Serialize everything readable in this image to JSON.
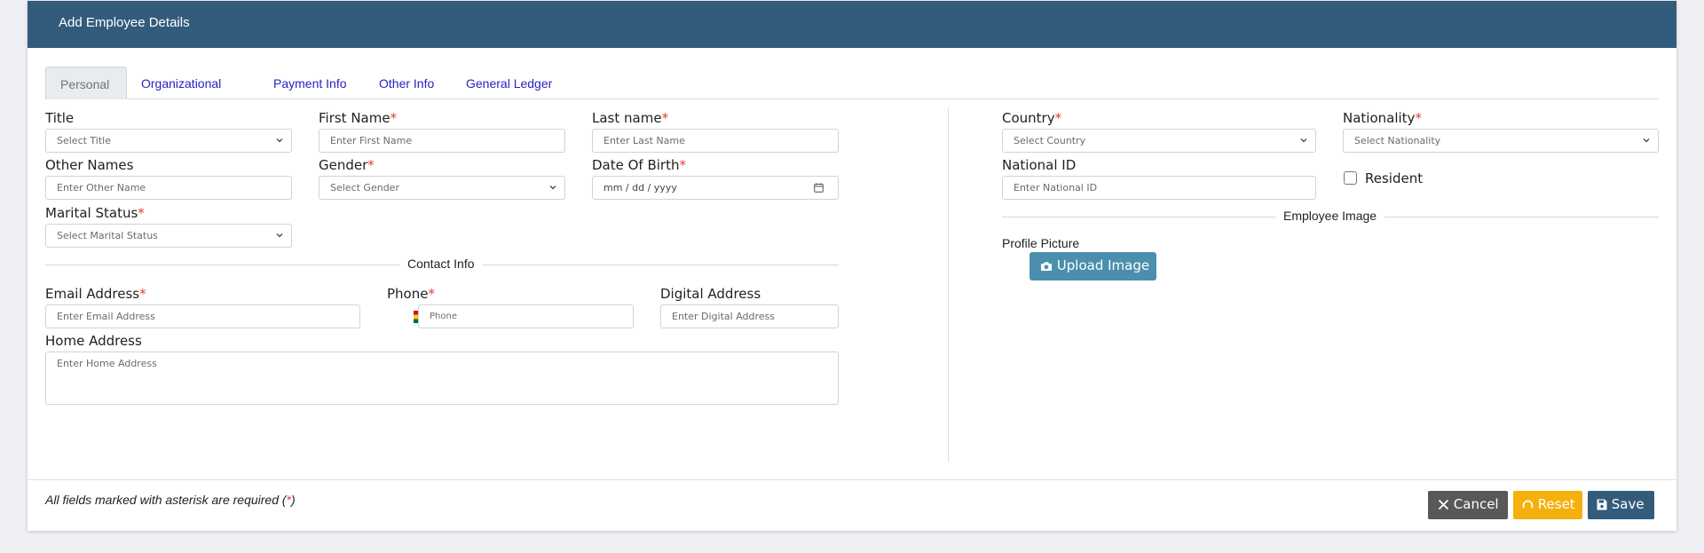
{
  "header": {
    "title": "Add Employee Details"
  },
  "tabs": [
    "Personal",
    "Organizational",
    "Payment Info",
    "Other Info",
    "General Ledger"
  ],
  "form": {
    "title": {
      "label": "Title",
      "placeholder": "Select Title"
    },
    "first_name": {
      "label": "First Name",
      "placeholder": "Enter First Name"
    },
    "last_name": {
      "label": "Last name",
      "placeholder": "Enter Last Name"
    },
    "other_names": {
      "label": "Other Names",
      "placeholder": "Enter Other Name"
    },
    "gender": {
      "label": "Gender",
      "placeholder": "Select Gender"
    },
    "dob": {
      "label": "Date Of Birth",
      "placeholder": "mm / dd / yyyy"
    },
    "marital_status": {
      "label": "Marital Status",
      "placeholder": "Select Marital Status"
    },
    "contact_heading": "Contact Info",
    "email": {
      "label": "Email Address",
      "placeholder": "Enter Email Address"
    },
    "phone": {
      "label": "Phone",
      "placeholder": "Phone"
    },
    "digital_address": {
      "label": "Digital Address",
      "placeholder": "Enter Digital Address"
    },
    "home_address": {
      "label": "Home Address",
      "placeholder": "Enter Home Address"
    },
    "country": {
      "label": "Country",
      "placeholder": "Select Country"
    },
    "nationality": {
      "label": "Nationality",
      "placeholder": "Select Nationality"
    },
    "national_id": {
      "label": "National ID",
      "placeholder": "Enter National ID"
    },
    "resident": {
      "label": "Resident"
    },
    "image_heading": "Employee Image",
    "profile_picture": {
      "label": "Profile Picture",
      "button": "Upload Image"
    }
  },
  "footer": {
    "note": "All fields marked with asterisk are required (",
    "note_star": "*",
    "note_end": ")",
    "cancel": "Cancel",
    "reset": "Reset",
    "save": "Save"
  },
  "required_mark": "*",
  "colors": {
    "header": "#325b7c",
    "cancel": "#585858",
    "reset": "#f5b00d",
    "save": "#325b7c",
    "upload": "#4a8fad",
    "required": "#e53935"
  },
  "icons": [
    "chevron-down-icon",
    "calendar-icon",
    "camera-icon",
    "close-icon",
    "reset-icon",
    "save-icon",
    "ghana-flag-icon"
  ]
}
